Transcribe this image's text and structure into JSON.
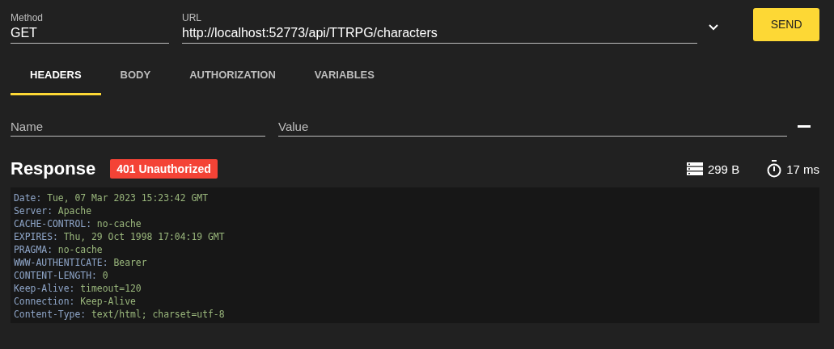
{
  "request": {
    "method": {
      "label": "Method",
      "value": "GET"
    },
    "url": {
      "label": "URL",
      "value": "http://localhost:52773/api/TTRPG/characters"
    },
    "send_button": "SEND"
  },
  "tabs": [
    {
      "label": "HEADERS",
      "selected": true
    },
    {
      "label": "BODY",
      "selected": false
    },
    {
      "label": "AUTHORIZATION",
      "selected": false
    },
    {
      "label": "VARIABLES",
      "selected": false
    }
  ],
  "header_row": {
    "name": {
      "placeholder": "Name"
    },
    "value": {
      "placeholder": "Value"
    }
  },
  "response": {
    "title": "Response",
    "status": "401 Unauthorized",
    "size": "299 B",
    "time": "17 ms",
    "headers": [
      {
        "name": "Date:",
        "value": "Tue, 07 Mar 2023 15:23:42 GMT"
      },
      {
        "name": "Server:",
        "value": "Apache"
      },
      {
        "name": "CACHE-CONTROL:",
        "value": "no-cache"
      },
      {
        "name": "EXPIRES:",
        "value": "Thu, 29 Oct 1998 17:04:19 GMT"
      },
      {
        "name": "PRAGMA:",
        "value": "no-cache"
      },
      {
        "name": "WWW-AUTHENTICATE:",
        "value": "Bearer"
      },
      {
        "name": "CONTENT-LENGTH:",
        "value": "0"
      },
      {
        "name": "Keep-Alive:",
        "value": "timeout=120"
      },
      {
        "name": "Connection:",
        "value": "Keep-Alive"
      },
      {
        "name": "Content-Type:",
        "value": "text/html; charset=utf-8"
      }
    ]
  }
}
